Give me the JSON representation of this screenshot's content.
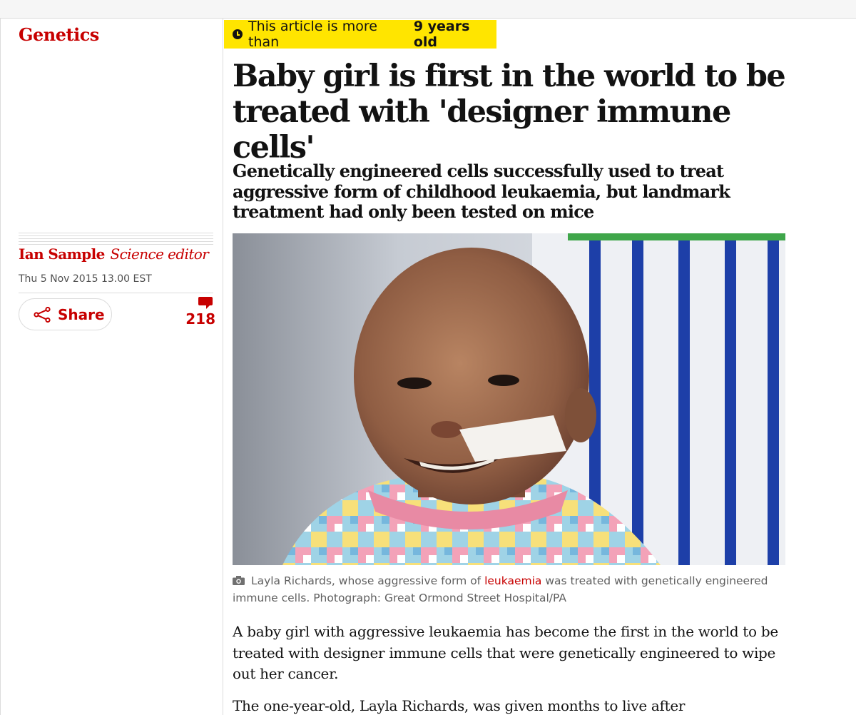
{
  "section": {
    "label": "Genetics"
  },
  "age_notice": {
    "prefix": "This article is more than",
    "age": "9 years old"
  },
  "article": {
    "headline": "Baby girl is first in the world to be treated with 'designer immune cells'",
    "standfirst": "Genetically engineered cells successfully used to treat aggressive form of childhood leukaemia, but landmark treatment had only been tested on mice",
    "byline": {
      "author": "Ian Sample",
      "role": "Science editor"
    },
    "dateline": "Thu 5 Nov 2015 13.00 EST",
    "share_label": "Share",
    "comment_count": "218",
    "image_caption": {
      "before": "Layla Richards, whose aggressive form of",
      "link": "leukaemia",
      "after": "was treated with genetically engineered immune cells. Photograph: Great Ormond Street Hospital/PA"
    },
    "paragraphs": [
      "A baby girl with aggressive leukaemia has become the first in the world to be treated with designer immune cells that were genetically engineered to wipe out her cancer.",
      "The one-year-old, Layla Richards, was given months to live after"
    ]
  },
  "icons": {
    "age": "clock-icon",
    "share": "share-icon",
    "comments": "comment-bubble-icon",
    "caption": "camera-icon"
  },
  "colors": {
    "accent_red": "#c70000",
    "badge_yellow": "#ffe500",
    "text": "#121212",
    "muted": "#606060"
  }
}
